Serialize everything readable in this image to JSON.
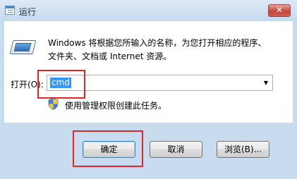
{
  "window": {
    "title": "运行",
    "close_label": "✕"
  },
  "description": {
    "line1": "Windows 将根据您所输入的名称，为您打开相应的程序、",
    "line2": "文件夹、文档或 Internet 资源。"
  },
  "open_field": {
    "label": "打开(O):",
    "value": "cmd"
  },
  "admin_note": "使用管理权限创建此任务。",
  "buttons": {
    "ok": "确定",
    "cancel": "取消",
    "browse": "浏览(B)..."
  },
  "colors": {
    "highlight_box": "#e3252a",
    "selection": "#3399ff"
  }
}
